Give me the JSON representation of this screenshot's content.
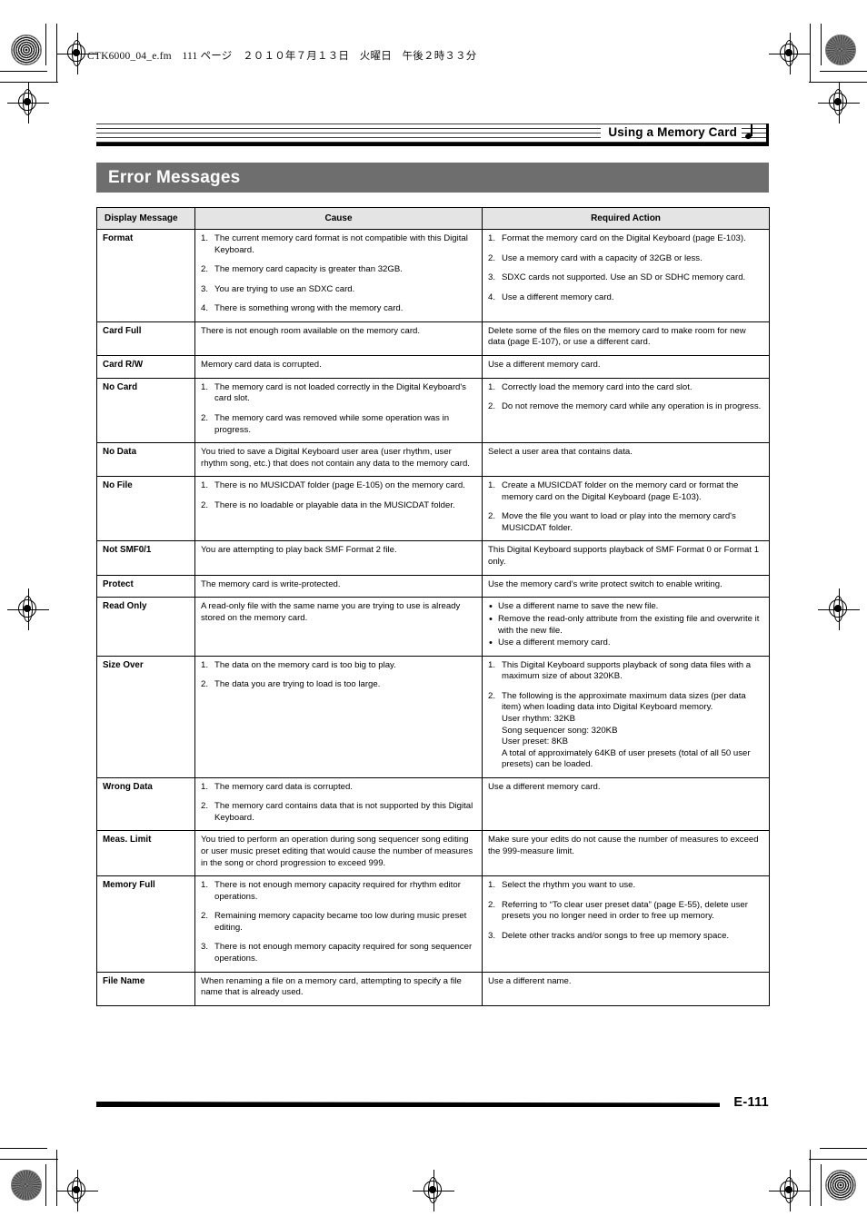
{
  "print_marks": {
    "file_slug": "CTK6000_04_e.fm　111 ページ　２０１０年７月１３日　火曜日　午後２時３３分"
  },
  "running_head": {
    "title": "Using a Memory Card",
    "note_icon": "quarter-note-icon"
  },
  "section": {
    "banner_title": "Error Messages",
    "banner_color": "#6e6e6e"
  },
  "table": {
    "headers": {
      "message": "Display Message",
      "cause": "Cause",
      "action": "Required Action"
    },
    "rows": [
      {
        "message": "Format",
        "cause_type": "numbered",
        "cause": [
          "The current memory card format is not compatible with this Digital Keyboard.",
          "The memory card capacity is greater than 32GB.",
          "You are trying to use an SDXC card.",
          "There is something wrong with the memory card."
        ],
        "action_type": "numbered",
        "action": [
          "Format the memory card on the Digital Keyboard (page E-103).",
          "Use a memory card with a capacity of 32GB or less.",
          "SDXC cards not supported. Use an SD or SDHC memory card.",
          "Use a different memory card."
        ]
      },
      {
        "message": "Card Full",
        "cause_type": "plain",
        "cause": [
          "There is not enough room available on the memory card."
        ],
        "action_type": "plain",
        "action": [
          "Delete some of the files on the memory card to make room for new data (page E-107), or use a different card."
        ]
      },
      {
        "message": "Card R/W",
        "cause_type": "plain",
        "cause": [
          "Memory card data is corrupted."
        ],
        "action_type": "plain",
        "action": [
          "Use a different memory card."
        ]
      },
      {
        "message": "No Card",
        "cause_type": "numbered",
        "cause": [
          "The memory card is not loaded correctly in the Digital Keyboard's card slot.",
          "The memory card was removed while some operation was in progress."
        ],
        "action_type": "numbered",
        "action": [
          "Correctly load the memory card into the card slot.",
          "Do not remove the memory card while any operation is in progress."
        ]
      },
      {
        "message": "No Data",
        "cause_type": "plain",
        "cause": [
          "You tried to save a Digital Keyboard user area (user rhythm, user rhythm song, etc.) that does not contain any data to the memory card."
        ],
        "action_type": "plain",
        "action": [
          "Select a user area that contains data."
        ]
      },
      {
        "message": "No File",
        "cause_type": "numbered",
        "cause": [
          "There is no MUSICDAT folder (page E-105) on the memory card.",
          "There is no loadable or playable data in the MUSICDAT folder."
        ],
        "action_type": "numbered",
        "action": [
          "Create a MUSICDAT folder on the memory card or format the memory card on the Digital Keyboard (page E-103).",
          "Move the file you want to load or play into the memory card's MUSICDAT folder."
        ]
      },
      {
        "message": "Not SMF0/1",
        "cause_type": "plain",
        "cause": [
          "You are attempting to play back SMF Format 2 file."
        ],
        "action_type": "plain",
        "action": [
          "This Digital Keyboard supports playback of SMF Format 0 or Format 1 only."
        ]
      },
      {
        "message": "Protect",
        "cause_type": "plain",
        "cause": [
          "The memory card is write-protected."
        ],
        "action_type": "plain",
        "action": [
          "Use the memory card's write protect switch to enable writing."
        ]
      },
      {
        "message": "Read Only",
        "cause_type": "plain",
        "cause": [
          "A read-only file with the same name you are trying to use is already stored on the memory card."
        ],
        "action_type": "bulleted",
        "action": [
          "Use a different name to save the new file.",
          "Remove the read-only attribute from the existing file and overwrite it with the new file.",
          "Use a different memory card."
        ]
      },
      {
        "message": "Size Over",
        "cause_type": "numbered",
        "cause": [
          "The data on the memory card is too big to play.",
          "The data you are trying to load is too large."
        ],
        "action_type": "numbered",
        "action": [
          "This Digital Keyboard supports playback of song data files with a maximum size of about 320KB.",
          "The following is the approximate maximum data sizes (per data item) when loading data into Digital Keyboard memory."
        ],
        "action_extra": [
          "User rhythm: 32KB",
          "Song sequencer song: 320KB",
          "User preset: 8KB",
          "A total of approximately 64KB of user presets (total of all 50 user presets) can be loaded."
        ]
      },
      {
        "message": "Wrong Data",
        "cause_type": "numbered",
        "cause": [
          "The memory card data is corrupted.",
          "The memory card contains data that is not supported by this Digital Keyboard."
        ],
        "action_type": "plain",
        "action": [
          "Use a different memory card."
        ]
      },
      {
        "message": "Meas. Limit",
        "cause_type": "plain",
        "cause": [
          "You tried to perform an operation during song sequencer song editing or user music preset editing that would cause the number of measures in the song or chord progression to exceed 999."
        ],
        "action_type": "plain",
        "action": [
          "Make sure your edits do not cause the number of measures to exceed the 999-measure limit."
        ]
      },
      {
        "message": "Memory Full",
        "cause_type": "numbered",
        "cause": [
          "There is not enough memory capacity required for rhythm editor operations.",
          "Remaining memory capacity became too low during music preset editing.",
          "There is not enough memory capacity required for song sequencer operations."
        ],
        "action_type": "numbered",
        "action": [
          "Select the rhythm you want to use.",
          "Referring to “To clear user preset data” (page E-55), delete user presets you no longer need in order to free up memory.",
          "Delete other tracks and/or songs to free up memory space."
        ]
      },
      {
        "message": "File Name",
        "cause_type": "plain",
        "cause": [
          "When renaming a file on a memory card, attempting to specify a file name that is already used."
        ],
        "action_type": "plain",
        "action": [
          "Use a different name."
        ]
      }
    ]
  },
  "footer": {
    "page_number": "E-111"
  }
}
